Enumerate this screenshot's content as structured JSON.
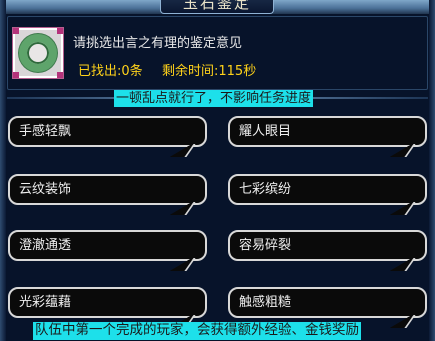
{
  "window": {
    "title": "玉石鉴定"
  },
  "item": {
    "icon": "jade-ring-icon",
    "prompt": "请挑选出言之有理的鉴定意见",
    "found_label": "已找出:0条",
    "time_label": "剩余时间:115秒"
  },
  "annotations": {
    "top": "一顿乱点就行了，不影响任务进度",
    "bottom": "队伍中第一个完成的玩家，会获得额外经验、金钱奖励"
  },
  "options": [
    {
      "label": "手感轻飘"
    },
    {
      "label": "耀人眼目"
    },
    {
      "label": "云纹装饰"
    },
    {
      "label": "七彩缤纷"
    },
    {
      "label": "澄澈通透"
    },
    {
      "label": "容易碎裂"
    },
    {
      "label": "光彩蕴藉"
    },
    {
      "label": "触感粗糙"
    }
  ],
  "colors": {
    "background": "#07132a",
    "highlight_text": "#ffd21a",
    "annotation_bg": "#1de0ea"
  }
}
